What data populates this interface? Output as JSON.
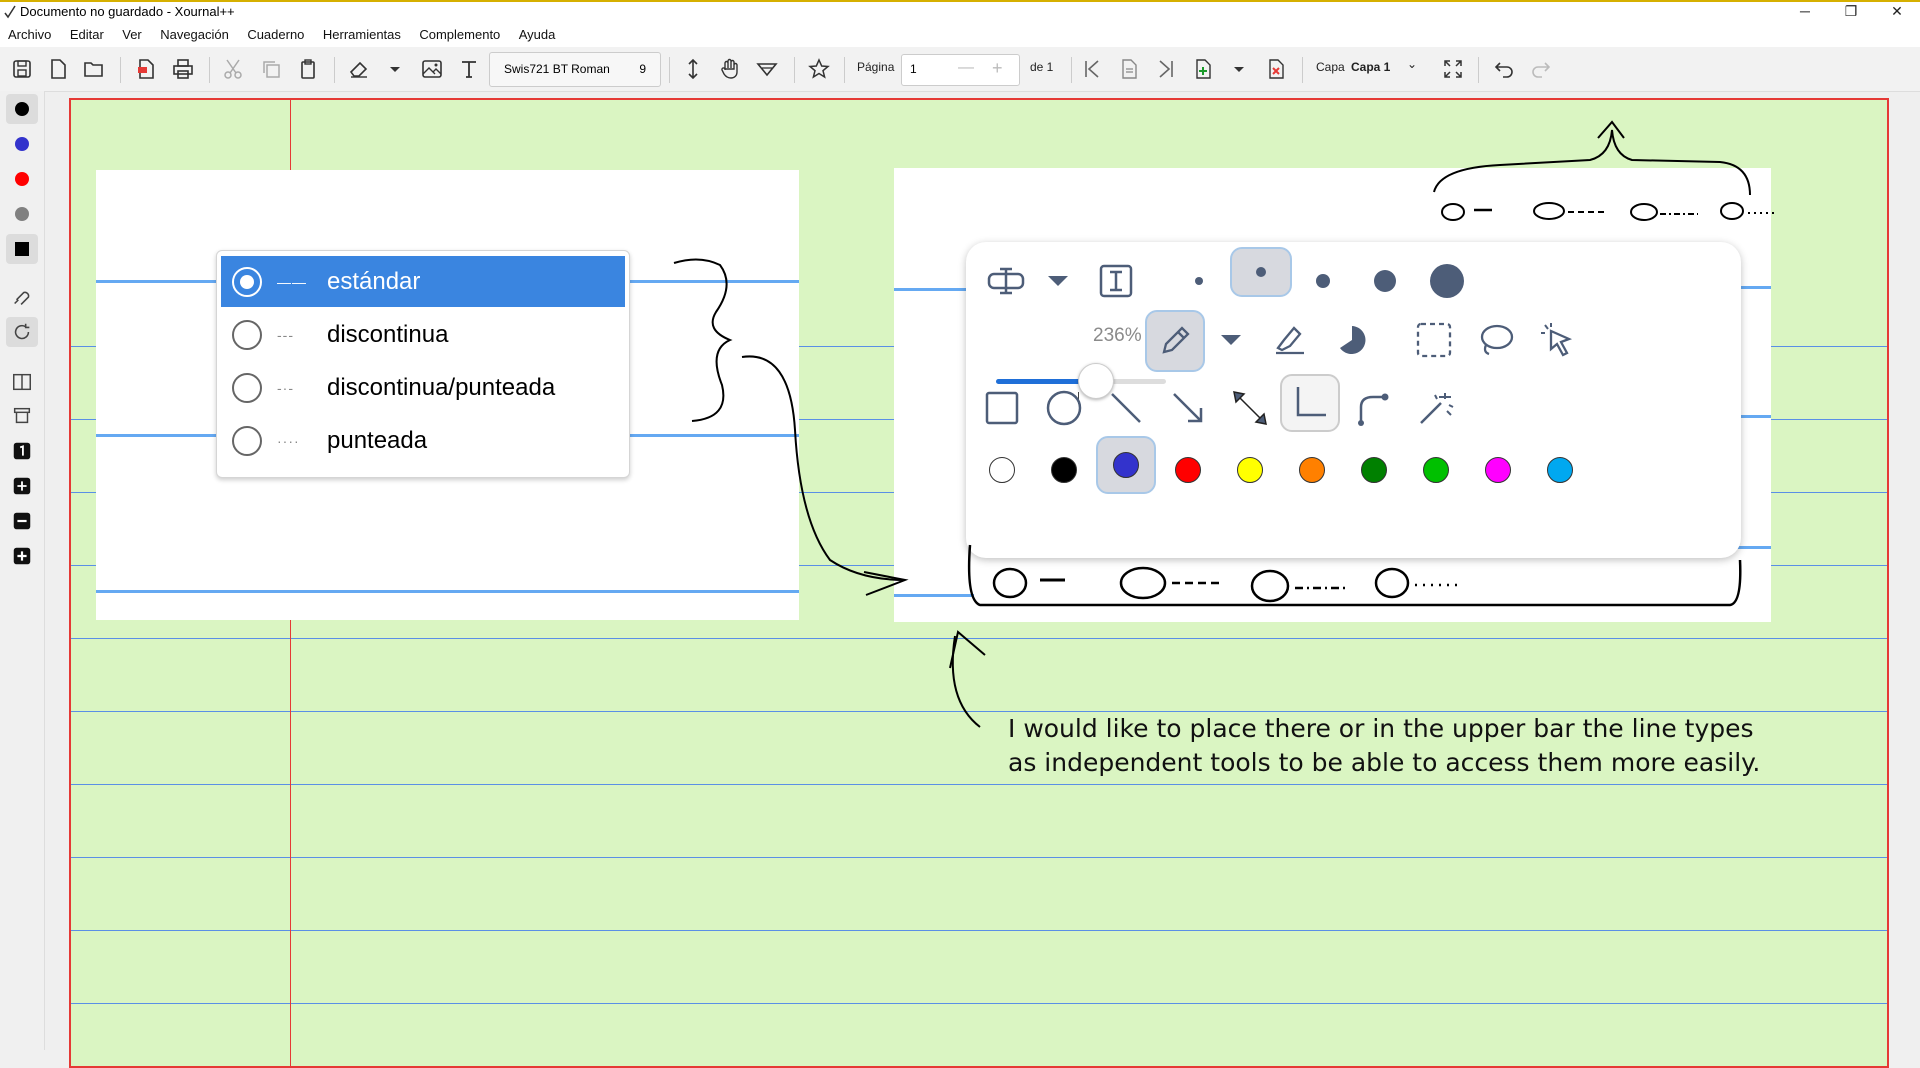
{
  "window": {
    "title": "Documento no guardado - Xournal++",
    "controls": [
      "─",
      "❐",
      "✕"
    ]
  },
  "menu": [
    "Archivo",
    "Editar",
    "Ver",
    "Navegación",
    "Cuaderno",
    "Herramientas",
    "Complemento",
    "Ayuda"
  ],
  "toolbar": {
    "font_name": "Swis721 BT Roman",
    "font_size": "9",
    "page_label": "Página",
    "page_value": "1",
    "page_minus": "—",
    "page_plus": "+",
    "page_of": "de 1",
    "layer_label": "Capa",
    "layer_value": "Capa 1",
    "layer_chevron": "⌄"
  },
  "line_style_menu": {
    "options": [
      {
        "label": "estándar",
        "glyph": "——",
        "selected": true
      },
      {
        "label": "discontinua",
        "glyph": "---",
        "selected": false
      },
      {
        "label": "discontinua/punteada",
        "glyph": "-·-",
        "selected": false
      },
      {
        "label": "punteada",
        "glyph": "····",
        "selected": false
      }
    ]
  },
  "tool_popup": {
    "zoom_label": "236%",
    "zoom_fraction": 0.58,
    "dot_sizes": [
      "very-fine",
      "fine",
      "medium",
      "thick",
      "very-thick"
    ],
    "selected_dot": 1,
    "colors": [
      "#ffffff",
      "#000000",
      "#3333cc",
      "#ff0000",
      "#ffff00",
      "#ff8000",
      "#008000",
      "#00c000",
      "#ff00ff",
      "#00a8f0"
    ],
    "selected_color": 2
  },
  "sidebar_colors": [
    "#000000",
    "#3333cc",
    "#ff0000",
    "#808080",
    "#000000"
  ],
  "annotation": {
    "line1": "I would like to place there or in the upper bar the line types",
    "line2": "as independent tools to be able to access them more easily."
  },
  "accent": "#3a85e0",
  "paper_color": "#daf5c2"
}
